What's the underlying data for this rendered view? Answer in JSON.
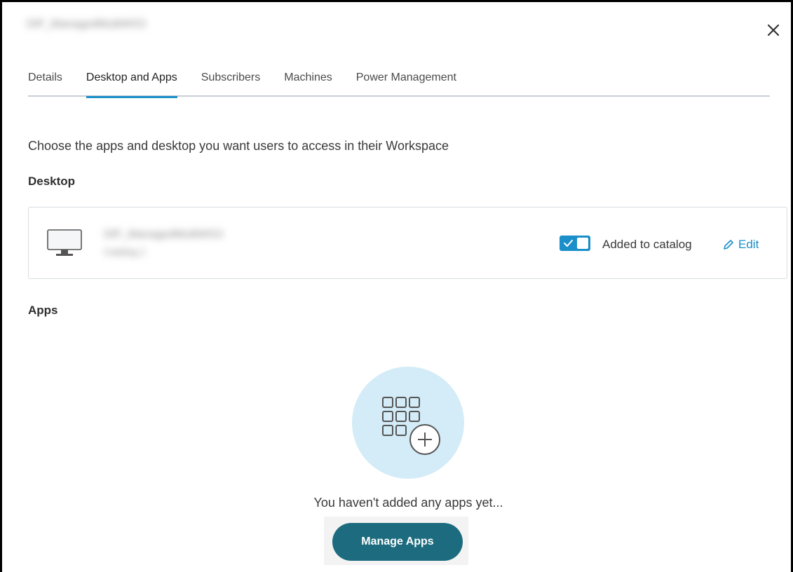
{
  "header": {
    "title": "DIF_ManagedMultiWS3"
  },
  "tabs": [
    {
      "label": "Details",
      "active": false
    },
    {
      "label": "Desktop and Apps",
      "active": true
    },
    {
      "label": "Subscribers",
      "active": false
    },
    {
      "label": "Machines",
      "active": false
    },
    {
      "label": "Power Management",
      "active": false
    }
  ],
  "main": {
    "intro": "Choose the apps and desktop you want users to access in their Workspace",
    "desktop_heading": "Desktop",
    "desktop": {
      "name": "DIF_ManagedMultiWS3",
      "subtitle": "Catalog 1",
      "catalog_label": "Added to catalog",
      "added_to_catalog": true,
      "edit_label": "Edit"
    },
    "apps_heading": "Apps",
    "empty_text": "You haven't added any apps yet...",
    "manage_button": "Manage Apps"
  },
  "colors": {
    "accent": "#1a8fc9",
    "button": "#1c6b7e",
    "empty_circle": "#d3ecf8"
  },
  "icons": [
    "close-icon",
    "monitor-icon",
    "pencil-icon",
    "apps-grid-add-icon"
  ]
}
